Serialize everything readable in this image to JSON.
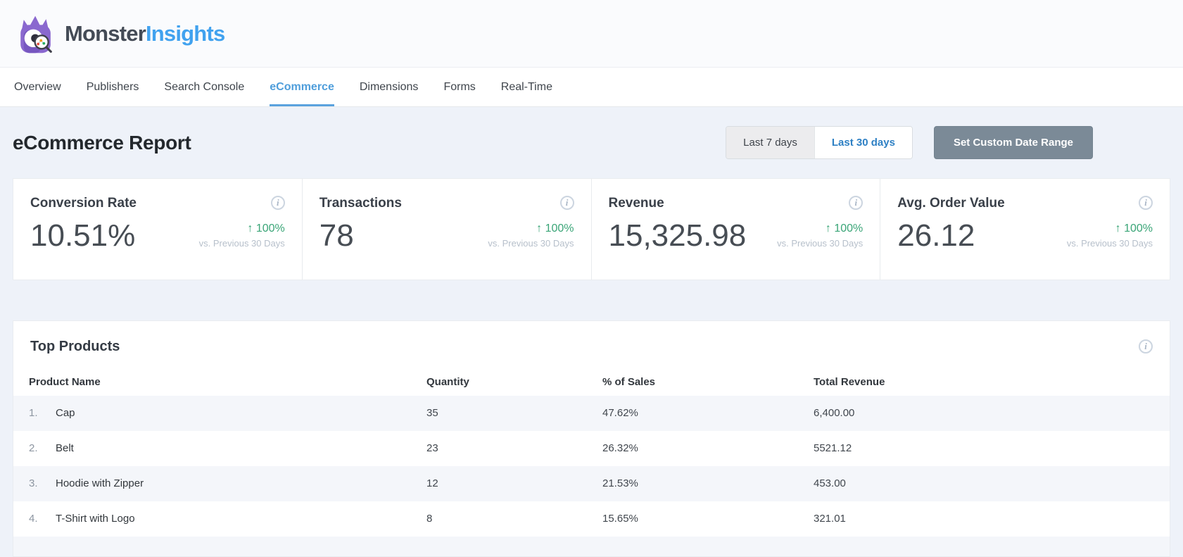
{
  "brand": {
    "name_part1": "Monster",
    "name_part2": "Insights"
  },
  "nav": {
    "tabs": [
      {
        "label": "Overview",
        "active": false
      },
      {
        "label": "Publishers",
        "active": false
      },
      {
        "label": "Search Console",
        "active": false
      },
      {
        "label": "eCommerce",
        "active": true
      },
      {
        "label": "Dimensions",
        "active": false
      },
      {
        "label": "Forms",
        "active": false
      },
      {
        "label": "Real-Time",
        "active": false
      }
    ]
  },
  "report": {
    "title": "eCommerce Report",
    "date_range": {
      "options": [
        {
          "label": "Last 7 days",
          "active": false
        },
        {
          "label": "Last 30 days",
          "active": true
        }
      ],
      "selected": "Last 30 days",
      "custom_button": "Set Custom Date Range"
    }
  },
  "metrics": [
    {
      "title": "Conversion Rate",
      "value": "10.51%",
      "arrow": "↑",
      "change": "100%",
      "compare_label": "vs. Previous 30 Days"
    },
    {
      "title": "Transactions",
      "value": "78",
      "arrow": "↑",
      "change": "100%",
      "compare_label": "vs. Previous 30 Days"
    },
    {
      "title": "Revenue",
      "value": "15,325.98",
      "arrow": "↑",
      "change": "100%",
      "compare_label": "vs. Previous 30 Days"
    },
    {
      "title": "Avg. Order Value",
      "value": "26.12",
      "arrow": "↑",
      "change": "100%",
      "compare_label": "vs. Previous 30 Days"
    }
  ],
  "top_products": {
    "title": "Top Products",
    "columns": [
      "Product Name",
      "Quantity",
      "% of Sales",
      "Total Revenue"
    ],
    "rows": [
      {
        "rank": "1.",
        "name": "Cap",
        "quantity": "35",
        "pct_of_sales": "47.62%",
        "total_revenue": "6,400.00"
      },
      {
        "rank": "2.",
        "name": "Belt",
        "quantity": "23",
        "pct_of_sales": "26.32%",
        "total_revenue": "5521.12"
      },
      {
        "rank": "3.",
        "name": "Hoodie with Zipper",
        "quantity": "12",
        "pct_of_sales": "21.53%",
        "total_revenue": "453.00"
      },
      {
        "rank": "4.",
        "name": "T-Shirt with Logo",
        "quantity": "8",
        "pct_of_sales": "15.65%",
        "total_revenue": "321.01"
      }
    ]
  },
  "icons": {
    "info": "info-icon",
    "up_arrow": "up-arrow-icon",
    "mascot": "monster-mascot-icon"
  },
  "colors": {
    "accent_blue": "#4f9edb",
    "selected_blue": "#2e80c4",
    "logo_blue": "#41a2ef",
    "positive_green": "#3aa577",
    "button_slate": "#7b8a97",
    "logo_purple": "#8a68cf",
    "page_background": "#eef2f9",
    "row_stripe": "#f4f6fa"
  }
}
